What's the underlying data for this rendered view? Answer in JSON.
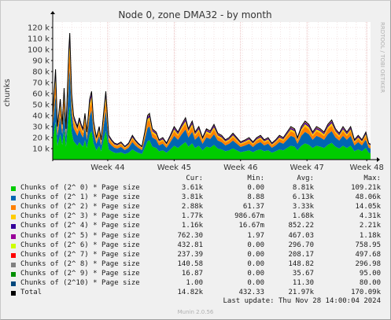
{
  "window": {
    "background": "#f0f0f0"
  },
  "chart_data": {
    "type": "area",
    "title": "Node 0, zone DMA32 - by month",
    "ylabel": "chunks",
    "side_label": "RRDTOOL / TOBI OETIKER",
    "ylim": [
      0,
      125000
    ],
    "y_ticks": [
      10000,
      20000,
      30000,
      40000,
      50000,
      60000,
      70000,
      80000,
      90000,
      100000,
      110000,
      120000
    ],
    "y_tick_labels": [
      "10 k",
      "20 k",
      "30 k",
      "40 k",
      "50 k",
      "60 k",
      "70 k",
      "80 k",
      "90 k",
      "100 k",
      "110 k",
      "120 k"
    ],
    "x_range_days": [
      0,
      33.5
    ],
    "x_ticks": [
      {
        "day": 5.8,
        "label": "Week 44"
      },
      {
        "day": 12.8,
        "label": "Week 45"
      },
      {
        "day": 19.8,
        "label": "Week 46"
      },
      {
        "day": 26.8,
        "label": "Week 47"
      },
      {
        "day": 33.1,
        "label": "Week 48"
      }
    ],
    "grid": true,
    "legend_placement": "bottom",
    "total_series": [
      [
        0,
        40000
      ],
      [
        0.3,
        82000
      ],
      [
        0.5,
        30000
      ],
      [
        0.8,
        55000
      ],
      [
        1.0,
        32000
      ],
      [
        1.2,
        65000
      ],
      [
        1.4,
        28000
      ],
      [
        1.7,
        100000
      ],
      [
        1.8,
        115000
      ],
      [
        2.0,
        60000
      ],
      [
        2.2,
        40000
      ],
      [
        2.4,
        35000
      ],
      [
        2.6,
        30000
      ],
      [
        2.8,
        38000
      ],
      [
        3.0,
        32000
      ],
      [
        3.2,
        28000
      ],
      [
        3.4,
        42000
      ],
      [
        3.6,
        25000
      ],
      [
        3.9,
        55000
      ],
      [
        4.1,
        62000
      ],
      [
        4.3,
        35000
      ],
      [
        4.6,
        20000
      ],
      [
        4.9,
        30000
      ],
      [
        5.1,
        18000
      ],
      [
        5.4,
        45000
      ],
      [
        5.6,
        62000
      ],
      [
        5.9,
        22000
      ],
      [
        6.2,
        18000
      ],
      [
        6.5,
        15000
      ],
      [
        6.8,
        14000
      ],
      [
        7.2,
        16000
      ],
      [
        7.6,
        12000
      ],
      [
        8.0,
        15000
      ],
      [
        8.4,
        22000
      ],
      [
        8.7,
        18000
      ],
      [
        9.0,
        15000
      ],
      [
        9.4,
        12000
      ],
      [
        9.7,
        25000
      ],
      [
        10.0,
        40000
      ],
      [
        10.2,
        42000
      ],
      [
        10.5,
        28000
      ],
      [
        10.9,
        25000
      ],
      [
        11.2,
        18000
      ],
      [
        11.6,
        20000
      ],
      [
        12.0,
        15000
      ],
      [
        12.4,
        22000
      ],
      [
        12.8,
        30000
      ],
      [
        13.2,
        25000
      ],
      [
        13.6,
        32000
      ],
      [
        14.0,
        38000
      ],
      [
        14.3,
        28000
      ],
      [
        14.7,
        35000
      ],
      [
        15.0,
        25000
      ],
      [
        15.4,
        30000
      ],
      [
        15.8,
        20000
      ],
      [
        16.2,
        28000
      ],
      [
        16.6,
        26000
      ],
      [
        17.0,
        32000
      ],
      [
        17.4,
        24000
      ],
      [
        17.8,
        22000
      ],
      [
        18.2,
        18000
      ],
      [
        18.6,
        20000
      ],
      [
        19.0,
        24000
      ],
      [
        19.4,
        20000
      ],
      [
        19.8,
        16000
      ],
      [
        20.3,
        18000
      ],
      [
        20.7,
        20000
      ],
      [
        21.1,
        16000
      ],
      [
        21.5,
        20000
      ],
      [
        21.9,
        22000
      ],
      [
        22.3,
        18000
      ],
      [
        22.7,
        20000
      ],
      [
        23.1,
        15000
      ],
      [
        23.5,
        18000
      ],
      [
        23.9,
        22000
      ],
      [
        24.3,
        20000
      ],
      [
        24.7,
        25000
      ],
      [
        25.1,
        30000
      ],
      [
        25.5,
        28000
      ],
      [
        25.8,
        20000
      ],
      [
        26.2,
        30000
      ],
      [
        26.6,
        35000
      ],
      [
        27.0,
        32000
      ],
      [
        27.4,
        25000
      ],
      [
        27.8,
        30000
      ],
      [
        28.2,
        28000
      ],
      [
        28.6,
        25000
      ],
      [
        29.0,
        32000
      ],
      [
        29.4,
        36000
      ],
      [
        29.8,
        28000
      ],
      [
        30.2,
        24000
      ],
      [
        30.6,
        30000
      ],
      [
        31.0,
        25000
      ],
      [
        31.4,
        30000
      ],
      [
        31.8,
        18000
      ],
      [
        32.2,
        22000
      ],
      [
        32.6,
        18000
      ],
      [
        33.0,
        25000
      ],
      [
        33.3,
        15000
      ],
      [
        33.5,
        14000
      ]
    ],
    "series": [
      {
        "name": "Chunks of (2^ 0) * Page size",
        "color": "#00cc00",
        "share": 0.42
      },
      {
        "name": "Chunks of (2^ 1) * Page size",
        "color": "#0066b3",
        "share": 0.3
      },
      {
        "name": "Chunks of (2^ 2) * Page size",
        "color": "#ff8000",
        "share": 0.14
      },
      {
        "name": "Chunks of (2^ 3) * Page size",
        "color": "#ffcc00",
        "share": 0.06
      },
      {
        "name": "Chunks of (2^ 4) * Page size",
        "color": "#330099",
        "share": 0.04
      },
      {
        "name": "Chunks of (2^ 5) * Page size",
        "color": "#990099",
        "share": 0.015
      },
      {
        "name": "Chunks of (2^ 6) * Page size",
        "color": "#ccff00",
        "share": 0.01
      },
      {
        "name": "Chunks of (2^ 7) * Page size",
        "color": "#ff0000",
        "share": 0.006
      },
      {
        "name": "Chunks of (2^ 8) * Page size",
        "color": "#808080",
        "share": 0.005
      },
      {
        "name": "Chunks of (2^ 9) * Page size",
        "color": "#008f00",
        "share": 0.002
      },
      {
        "name": "Chunks of (2^10) * Page size",
        "color": "#00487d",
        "share": 0.002
      }
    ],
    "total_name": "Total",
    "total_color": "#000000"
  },
  "legend": {
    "headers": {
      "cur": "Cur:",
      "min": "Min:",
      "avg": "Avg:",
      "max": "Max:"
    },
    "rows": [
      {
        "name": "Chunks of (2^ 0) * Page size",
        "color": "#00cc00",
        "cur": "3.61k",
        "min": "0.00",
        "avg": "8.81k",
        "max": "109.21k"
      },
      {
        "name": "Chunks of (2^ 1) * Page size",
        "color": "#0066b3",
        "cur": "3.81k",
        "min": "8.88",
        "avg": "6.13k",
        "max": "48.06k"
      },
      {
        "name": "Chunks of (2^ 2) * Page size",
        "color": "#ff8000",
        "cur": "2.88k",
        "min": "61.37",
        "avg": "3.33k",
        "max": "14.05k"
      },
      {
        "name": "Chunks of (2^ 3) * Page size",
        "color": "#ffcc00",
        "cur": "1.77k",
        "min": "986.67m",
        "avg": "1.68k",
        "max": "4.31k"
      },
      {
        "name": "Chunks of (2^ 4) * Page size",
        "color": "#330099",
        "cur": "1.16k",
        "min": "16.67m",
        "avg": "852.22",
        "max": "2.21k"
      },
      {
        "name": "Chunks of (2^ 5) * Page size",
        "color": "#990099",
        "cur": "762.30",
        "min": "1.97",
        "avg": "467.03",
        "max": "1.18k"
      },
      {
        "name": "Chunks of (2^ 6) * Page size",
        "color": "#ccff00",
        "cur": "432.81",
        "min": "0.00",
        "avg": "296.70",
        "max": "758.95"
      },
      {
        "name": "Chunks of (2^ 7) * Page size",
        "color": "#ff0000",
        "cur": "237.39",
        "min": "0.00",
        "avg": "208.17",
        "max": "497.68"
      },
      {
        "name": "Chunks of (2^ 8) * Page size",
        "color": "#808080",
        "cur": "140.58",
        "min": "0.00",
        "avg": "148.82",
        "max": "296.98"
      },
      {
        "name": "Chunks of (2^ 9) * Page size",
        "color": "#008f00",
        "cur": "16.87",
        "min": "0.00",
        "avg": "35.67",
        "max": "95.00"
      },
      {
        "name": "Chunks of (2^10) * Page size",
        "color": "#00487d",
        "cur": "1.00",
        "min": "0.00",
        "avg": "11.30",
        "max": "80.00"
      },
      {
        "name": "Total",
        "color": "#000000",
        "cur": "14.82k",
        "min": "432.33",
        "avg": "21.97k",
        "max": "170.09k"
      }
    ]
  },
  "footer": {
    "last_update": "Last update: Thu Nov 28 14:00:04 2024",
    "munin": "Munin 2.0.56"
  }
}
